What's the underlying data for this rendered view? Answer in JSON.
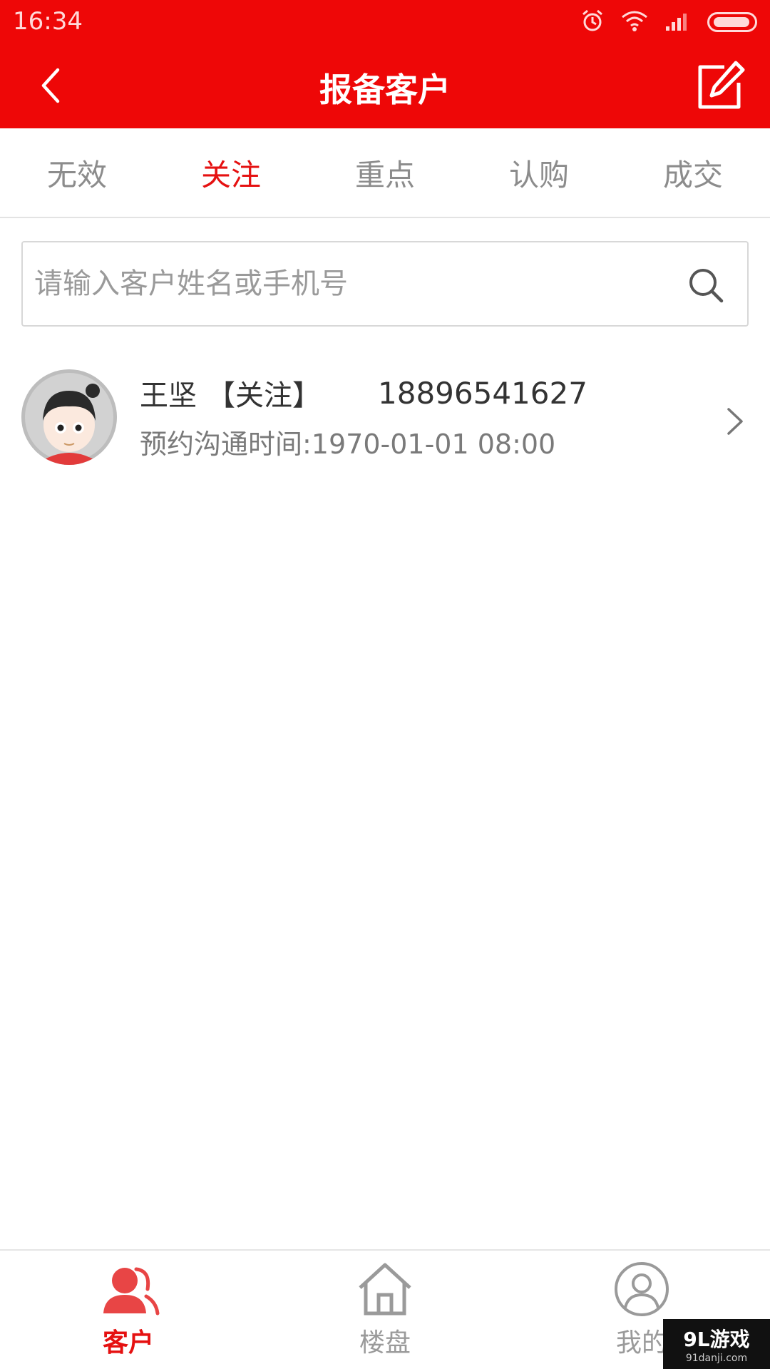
{
  "status_bar": {
    "time": "16:34"
  },
  "header": {
    "title": "报备客户"
  },
  "tabs": [
    {
      "label": "无效",
      "active": false
    },
    {
      "label": "关注",
      "active": true
    },
    {
      "label": "重点",
      "active": false
    },
    {
      "label": "认购",
      "active": false
    },
    {
      "label": "成交",
      "active": false
    }
  ],
  "search": {
    "placeholder": "请输入客户姓名或手机号",
    "value": ""
  },
  "customers": [
    {
      "name": "王坚",
      "tag": "【关注】",
      "phone": "18896541627",
      "contact_time": "预约沟通时间:1970-01-01 08:00"
    }
  ],
  "bottom_nav": [
    {
      "label": "客户",
      "icon": "customers-icon",
      "active": true
    },
    {
      "label": "楼盘",
      "icon": "building-icon",
      "active": false
    },
    {
      "label": "我的",
      "icon": "profile-icon",
      "active": false
    }
  ],
  "watermark": {
    "main": "9L游戏",
    "sub": "91danji.com"
  },
  "colors": {
    "brand_red": "#ee0707",
    "active_text": "#e51111"
  }
}
